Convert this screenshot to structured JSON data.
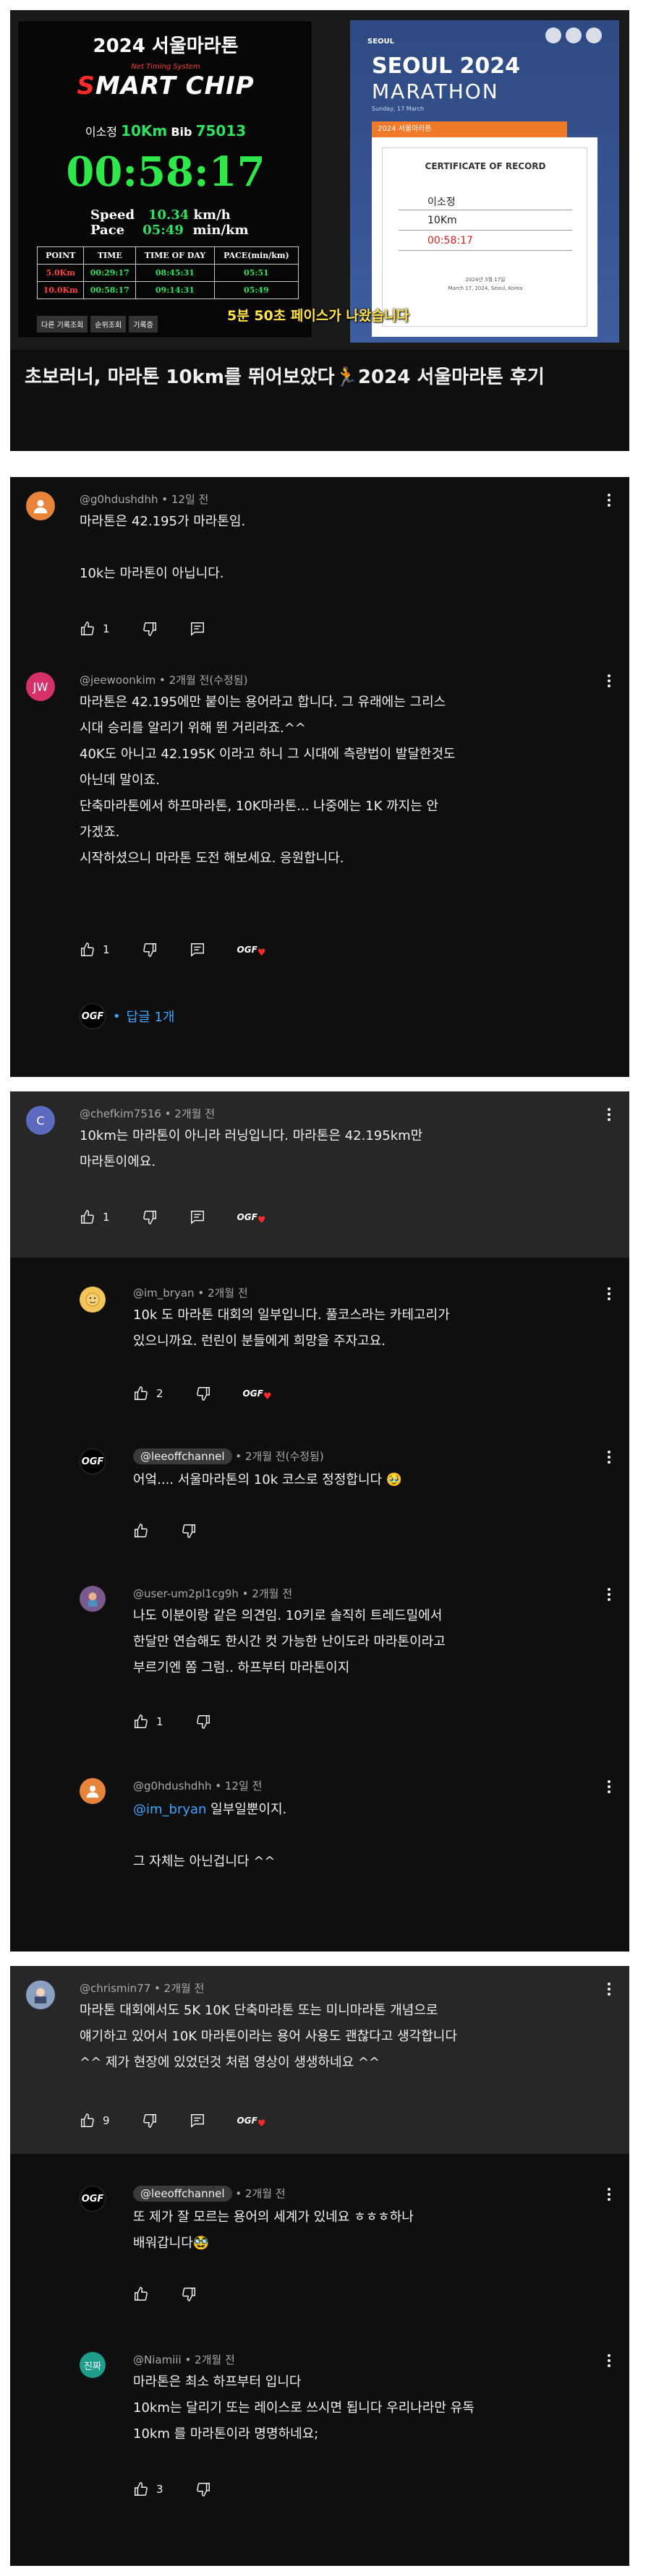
{
  "video": {
    "board": {
      "title": "2024 서울마라톤",
      "subtitle": "Net Timing System",
      "logo_s": "S",
      "logo_rest": "MART CHIP",
      "runner_name": "이소정",
      "runner_course": "10Km",
      "runner_bib_label": "Bib",
      "runner_bib": "75013",
      "time": "00:58:17",
      "speed_label": "Speed",
      "speed_value": "10.34",
      "speed_unit": "km/h",
      "pace_label": "Pace",
      "pace_value": "05:49",
      "pace_unit": "min/km",
      "table_headers": [
        "POINT",
        "TIME",
        "TIME OF DAY",
        "PACE(min/km)"
      ],
      "table_rows": [
        [
          "5.0Km",
          "00:29:17",
          "08:45:31",
          "05:51"
        ],
        [
          "10.0Km",
          "00:58:17",
          "09:14:31",
          "05:49"
        ]
      ],
      "buttons": [
        "다른 기록조회",
        "순위조회",
        "기록증"
      ]
    },
    "certificate": {
      "brand": "SEOUL",
      "seoul": "SEOUL 2024",
      "marathon": "MARATHON",
      "date": "Sunday, 17 March",
      "orange_label": "2024 서울마라톤",
      "title": "CERTIFICATE OF RECORD",
      "name": "이소정",
      "course": "10Km",
      "time": "00:58:17",
      "footer": "2024년 3월 17일\nMarch 17, 2024, Seoul, Korea"
    },
    "caption": "5분 50초 페이스가 나왔습니다",
    "title": "초보러너, 마라톤 10km를 뛰어보았다🏃2024 서울마라톤 후기"
  },
  "ui": {
    "like_icon": "thumbs-up-icon",
    "dislike_icon": "thumbs-down-icon",
    "reply_icon": "reply-icon",
    "more_icon": "more-vert-icon"
  },
  "thread1": {
    "c1": {
      "initial": "",
      "handle": "@g0hdushdhh",
      "time": "12일 전",
      "text": "마라톤은 42.195가 마라톤임.\n\n10k는 마라톤이 아닙니다.",
      "likes": "1"
    }
  },
  "thread1b": {
    "c1": {
      "initial": "JW",
      "handle": "@jeewoonkim",
      "time": "2개월 전(수정됨)",
      "text": "마라톤은 42.195에만 붙이는 용어라고 합니다. 그 유래에는 그리스\n시대 승리를 알리기 위해 뛴 거리라죠.^^\n40K도 아니고 42.195K 이라고 하니 그 시대에 측량법이 발달한것도\n아닌데 말이죠.\n단축마라톤에서 하프마라톤, 10K마라톤... 나중에는 1K 까지는 안\n가겠죠.\n시작하셨으니 마라톤 도전 해보세요. 응원합니다.",
      "likes": "1"
    },
    "replies_link": "답글 1개"
  },
  "thread2": {
    "c1": {
      "initial": "C",
      "handle": "@chefkim7516",
      "time": "2개월 전",
      "text": "10km는 마라톤이 아니라 러닝입니다. 마라톤은 42.195km만\n마라톤이에요.",
      "likes": "1"
    },
    "r1": {
      "handle": "@im_bryan",
      "time": "2개월 전",
      "text": "10k 도 마라톤 대회의 일부입니다. 풀코스라는 카테고리가\n있으니까요. 런린이 분들에게 희망을 주자고요.",
      "likes": "2"
    },
    "r2": {
      "handle": "@leeoffchannel",
      "time": "2개월 전(수정됨)",
      "text": "어엌.... 서울마라톤의 10k 코스로 정정합니다 🥹",
      "likes": ""
    },
    "r3": {
      "handle": "@user-um2pl1cg9h",
      "time": "2개월 전",
      "text": "나도 이분이랑 같은 의견임. 10키로 솔직히 트레드밀에서\n한달만 연습해도 한시간 컷 가능한 난이도라 마라톤이라고\n부르기엔 쫌 그럼.. 하프부터 마라톤이지",
      "likes": "1"
    },
    "r4": {
      "handle": "@g0hdushdhh",
      "time": "12일 전",
      "mention": "@im_bryan",
      "text_after_mention": " 일부일뿐이지.",
      "text2": "그 자체는 아닌겁니다 ^^"
    }
  },
  "thread3": {
    "c1": {
      "handle": "@chrismin77",
      "time": "2개월 전",
      "text": "마라톤 대회에서도 5K 10K 단축마라톤 또는 미니마라톤 개념으로\n얘기하고 있어서 10K 마라톤이라는 용어 사용도 괜찮다고 생각합니다\n^^ 제가 현장에 있었던것 처럼 영상이 생생하네요 ^^",
      "likes": "9"
    },
    "r1": {
      "handle": "@leeoffchannel",
      "time": "2개월 전",
      "text": "또 제가 잘 모르는 용어의 세계가 있네요 ㅎㅎㅎ하나\n배워갑니다🥸",
      "likes": ""
    },
    "r2": {
      "initial": "진짜",
      "handle": "@Niamiii",
      "time": "2개월 전",
      "text": "마라톤은 최소 하프부터 입니다\n10km는 달리기 또는 레이스로 쓰시면 됩니다 우리나라만 유독\n10km 를 마라톤이라 명명하네요;",
      "likes": "3"
    }
  },
  "channel_badge": "OGF",
  "colors": {
    "bg": "#0f0f0f",
    "text": "#f1f1f1",
    "meta": "#aaaaaa",
    "link": "#3ea6ff",
    "timer_green": "#2ee84a"
  }
}
